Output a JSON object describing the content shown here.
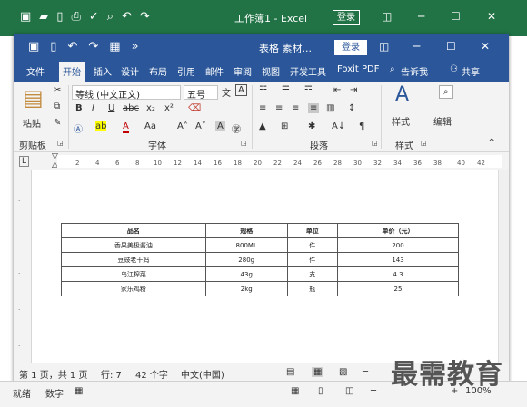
{
  "excel": {
    "title": "工作簿1 - Excel",
    "login": "登录",
    "status": {
      "ready": "就绪",
      "numlock": "数字",
      "zoom": "100%"
    }
  },
  "word": {
    "title": "表格 素材...",
    "login": "登录",
    "tabs": [
      "文件",
      "开始",
      "插入",
      "设计",
      "布局",
      "引用",
      "邮件",
      "审阅",
      "视图",
      "开发工具",
      "Foxit PDF",
      "告诉我",
      "共享"
    ],
    "ribbon": {
      "clipboard_group": "剪贴板",
      "paste": "粘贴",
      "font_name": "等线 (中文正文)",
      "font_size": "五号",
      "font_group": "字体",
      "paragraph_group": "段落",
      "styles_group": "样式",
      "styles_button": "样式",
      "edit_button": "编辑"
    },
    "ruler_ticks": [
      "2",
      "4",
      "6",
      "8",
      "10",
      "12",
      "14",
      "16",
      "18",
      "20",
      "22",
      "24",
      "26",
      "28",
      "30",
      "32",
      "34",
      "36",
      "38",
      "40",
      "42"
    ],
    "table": {
      "headers": [
        "品名",
        "规格",
        "单位",
        "单价（元）"
      ],
      "rows": [
        [
          "香果美极酱油",
          "800ML",
          "件",
          "200"
        ],
        [
          "豆豉老干妈",
          "280g",
          "件",
          "143"
        ],
        [
          "乌江榨菜",
          "43g",
          "支",
          "4.3"
        ],
        [
          "家乐鸡粉",
          "2kg",
          "瓶",
          "25"
        ]
      ]
    },
    "status": {
      "page": "第 1 页，共 1 页",
      "line": "行: 7",
      "words": "42 个字",
      "language": "中文(中国)"
    }
  },
  "watermark": "最需教育"
}
